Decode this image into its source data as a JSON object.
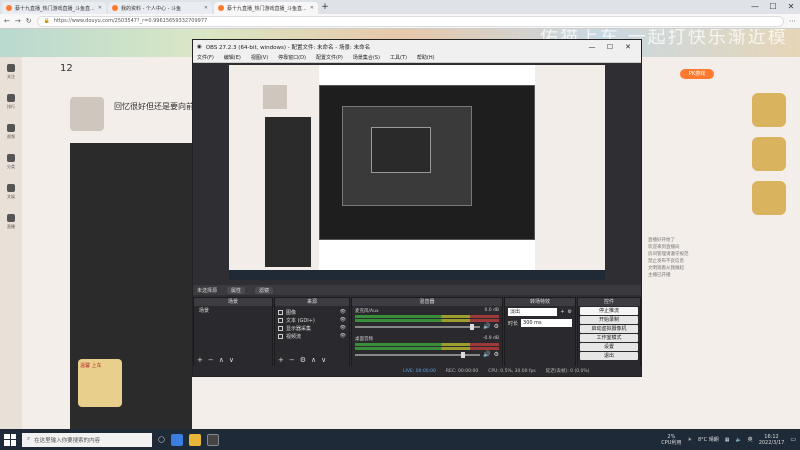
{
  "browser": {
    "tabs": [
      {
        "label": "蔡十九直播_热门游戏直播_斗鱼直...",
        "active": false
      },
      {
        "label": "我的资料 - 个人中心 - 斗鱼",
        "active": false
      },
      {
        "label": "蔡十九直播_热门游戏直播_斗鱼直...",
        "active": true
      }
    ],
    "new_tab": "+",
    "window_controls": [
      "—",
      "☐",
      "✕"
    ],
    "url": "https://www.douyu.com/2503547?_r=0.99615659332709977"
  },
  "douyu": {
    "banner_text": "佑猫上车 一起打快乐渐近模式",
    "left_rail": [
      "关注",
      "排行",
      "视频",
      "分类",
      "文娱",
      "直播"
    ],
    "room_title": "回忆很好但还是要向前",
    "stat_number": "12",
    "pk_button": "PK游戏",
    "follow_card_text": "温馨 上车",
    "notice_lines": [
      "直播好开始了",
      "欢迎来到直播间",
      "房间管理请遵守规范",
      "禁止发布不良信息",
      "文明观看从我做起",
      "主播已开播"
    ]
  },
  "obs": {
    "title": "OBS 27.2.3 (64-bit, windows) - 配置文件: 未命名 - 场景: 未命名",
    "window_controls": [
      "—",
      "☐",
      "✕"
    ],
    "menu": [
      "文件(F)",
      "编辑(E)",
      "视图(V)",
      "停靠窗口(D)",
      "配置文件(P)",
      "场景集合(S)",
      "工具(T)",
      "帮助(H)"
    ],
    "scene_bar": {
      "label": "未选择源",
      "props": "属性",
      "filters": "滤镜"
    },
    "docks": {
      "scenes": {
        "title": "场景",
        "items": [
          "场景"
        ]
      },
      "sources": {
        "title": "来源",
        "items": [
          "图像",
          "文本 (GDI+)",
          "显示器采集",
          "视频流"
        ]
      },
      "mixer": {
        "title": "混音器",
        "channels": [
          {
            "name": "麦克风/Aux",
            "db": "0.0 dB"
          },
          {
            "name": "桌面音频",
            "db": "-0.9 dB"
          }
        ]
      },
      "transitions": {
        "title": "转场特效",
        "type": "淡出",
        "duration_label": "时长",
        "duration": "300 ms"
      },
      "controls": {
        "title": "控件",
        "buttons": [
          "停止推流",
          "开始录制",
          "启动虚拟摄像机",
          "工作室模式",
          "设置",
          "退出"
        ]
      }
    },
    "status": {
      "live": "LIVE: 00:00:00",
      "rec": "REC: 00:00:00",
      "cpu": "CPU: 0.5%, 30.00 fps",
      "kbps": "延迟(丢帧): 0 (0.0%)"
    }
  },
  "taskbar": {
    "search_placeholder": "在这里输入你要搜索的内容",
    "cpu_percent": "2%",
    "cpu_label": "CPU利用",
    "weather": "8°C 晴朗",
    "ime": "英",
    "time": "16:12",
    "date": "2022/3/17"
  }
}
